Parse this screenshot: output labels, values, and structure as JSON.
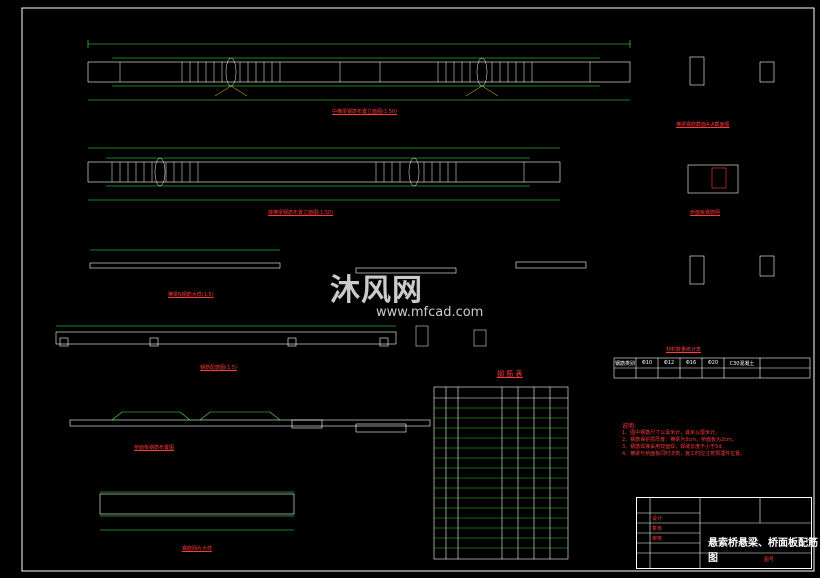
{
  "drawing_title": "悬索桥悬梁、桥面板配筋图",
  "watermark": {
    "logo": "沐风网",
    "url": "www.mfcad.com"
  },
  "views": {
    "view1": "中横梁钢筋布置立面图(1:50)",
    "view2": "端横梁钢筋布置立面图(1:50)",
    "view3": "横梁N钢筋大样(1:5)",
    "view4": "钢筋配筋图(1:5)",
    "view5": "桥面板钢筋布置图",
    "view6": "钢筋网片大样",
    "view7": "桥面板钢筋网",
    "view8": "横梁钢筋截面A-A截面图"
  },
  "table_title": "钢 筋 表",
  "material_table_title": "材料数量统计表",
  "material_table": [
    "钢筋类别",
    "Φ10",
    "Φ12",
    "Φ16",
    "Φ20",
    "C30混凝土"
  ],
  "notes": {
    "title": "说明:",
    "items": [
      "1、图中钢筋尺寸以毫米计，其余以厘米计。",
      "2、钢筋保护层厚度：横梁为3cm，桥面板为2cm。",
      "3、钢筋焊接采用双面焊，焊缝长度不小于5d。",
      "4、横梁与桥面板同时浇筑，施工时应注意预埋件位置。"
    ]
  },
  "title_block": {
    "row1": "设计",
    "row2": "复核",
    "row3": "审核",
    "drawing_no": "图号"
  }
}
